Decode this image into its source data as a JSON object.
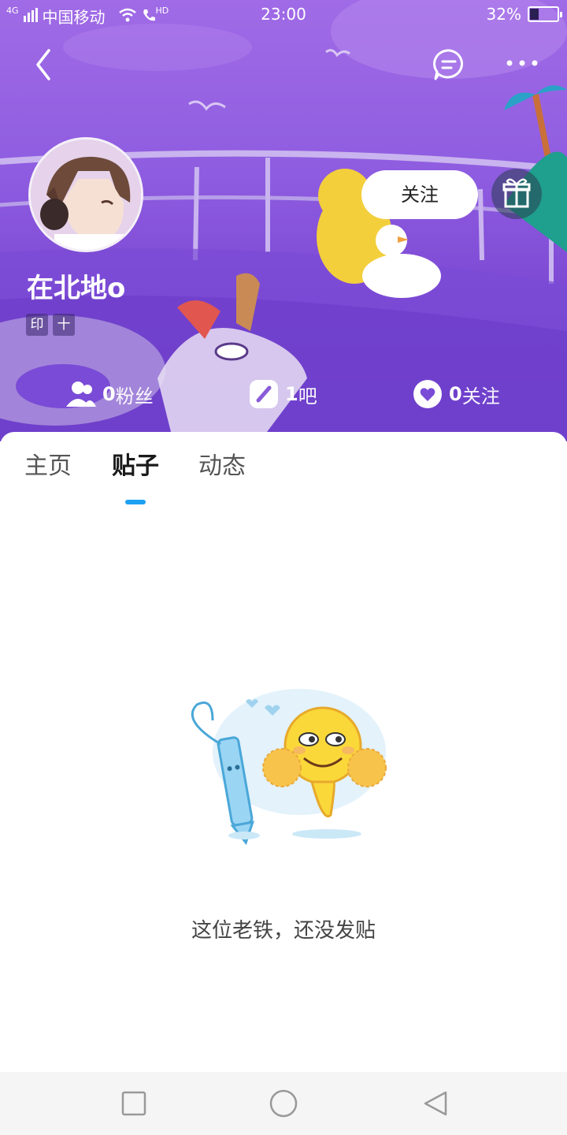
{
  "status_bar": {
    "network": "4G",
    "carrier": "中国移动",
    "hd": "HD",
    "time": "23:00",
    "battery": "32%",
    "battery_level": 0.32
  },
  "profile": {
    "username": "在北地o",
    "badges": [
      "印",
      "十"
    ],
    "follow_label": "关注"
  },
  "stats": [
    {
      "value": "0",
      "label": "粉丝",
      "icon": "fans-icon"
    },
    {
      "value": "1",
      "label": "吧",
      "icon": "bar-icon"
    },
    {
      "value": "0",
      "label": "关注",
      "icon": "heart-icon"
    }
  ],
  "tabs": [
    {
      "label": "主页",
      "active": false
    },
    {
      "label": "贴子",
      "active": true
    },
    {
      "label": "动态",
      "active": false
    }
  ],
  "empty_state": {
    "message": "这位老铁，还没发贴"
  },
  "colors": {
    "banner_top": "#a06be6",
    "banner_bottom": "#6a3ac6",
    "tab_indicator": "#1da1f2"
  }
}
